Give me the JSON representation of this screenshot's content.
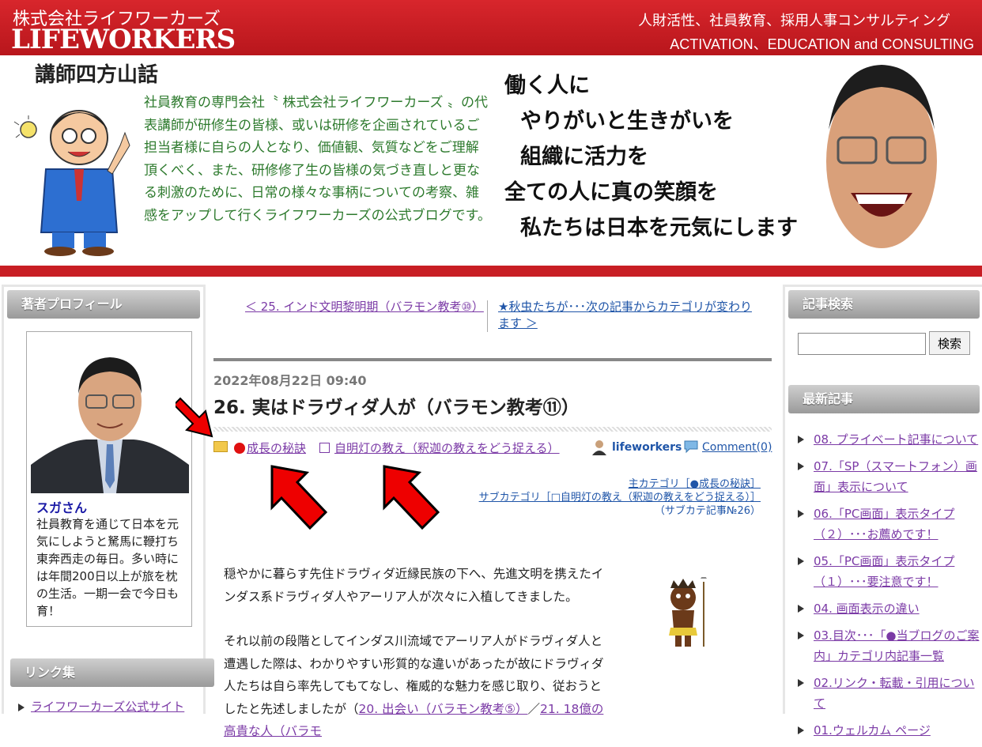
{
  "header": {
    "company_jp": "株式会社ライフワーカーズ",
    "company_en": "LIFEWORKERS",
    "tagline_jp": "人財活性、社員教育、採用人事コンサルティング",
    "tagline_en": "ACTIVATION、EDUCATION and CONSULTING",
    "blog_name": "講師四方山話",
    "intro": "社員教育の専門会社〝 株式会社ライフワーカーズ 〟の代表講師が研修生の皆様、或いは研修を企画されているご担当者様に自らの人となり、価値観、気質などをご理解頂くべく、また、研修修了生の皆様の気づき直しと更なる刺激のために、日常の様々な事柄についての考察、雑感をアップして行くライフワーカーズの公式ブログです。",
    "slogan": [
      "働く人に",
      "やりがいと生きがいを",
      "組織に活力を",
      "全ての人に真の笑顔を",
      "私たちは日本を元気にします"
    ]
  },
  "left_sidebar": {
    "profile_heading": "著者プロフィール",
    "author_name": "スガさん",
    "author_desc": "社員教育を通じて日本を元気にしようと駑馬に鞭打ち東奔西走の毎日。多い時には年間200日以上が旅を枕の生活。一期一会で今日も育！",
    "links_heading": "リンク集",
    "links": [
      "ライフワーカーズ公式サイト"
    ]
  },
  "right_sidebar": {
    "search_heading": "記事検索",
    "search_value": "",
    "search_button": "検索",
    "recent_heading": "最新記事",
    "recent": [
      "08. プライベート記事について",
      "07.「SP（スマートフォン）画面」表示について",
      "06.「PC画面」表示タイプ（２）･･･お薦めです！",
      "05.「PC画面」表示タイプ（１）･･･要注意です！",
      "04. 画面表示の違い",
      "03.目次･･･「●当ブログのご案内」カテゴリ内記事一覧",
      "02.リンク・転載・引用について",
      "01.ウェルカム ページ"
    ]
  },
  "main": {
    "prev": "＜ 25. インド文明黎明期（バラモン教考⑩）",
    "next": "★秋虫たちが･･･次の記事からカテゴリが変わります ＞",
    "date": "2022年08月22日 09:40",
    "title": "26. 実はドラヴィダ人が（バラモン教考⑪）",
    "category1": "成長の秘訣",
    "category2": "自明灯の教え（釈迦の教えをどう捉える）",
    "author": "lifeworkers",
    "comment": "Comment(0)",
    "cat_main": "主カテゴリ［●成長の秘訣］",
    "cat_sub": "サブカテゴリ［□自明灯の教え（釈迦の教えをどう捉える）］",
    "cat_count": "（サブカテ記事№26）",
    "para1": "穏やかに暮らす先住ドラヴィダ近縁民族の下へ、先進文明を携えたインダス系ドラヴィダ人やアーリア人が次々に入植してきました。",
    "para2": "それ以前の段階としてインダス川流域でアーリア人がドラヴィダ人と遭遇した際は、わかりやすい形質的な違いがあったが故にドラヴィダ人たちは自ら率先してもてなし、権威的な魅力を感じ取り、従おうとしたと先述しましたが（",
    "link1": "20. 出会い（バラモン教考⑤）",
    "sep": "／",
    "link2": "21. 18億の高貴な人（バラモ"
  },
  "colors": {
    "brand_red": "#c81e24",
    "link_purple": "#7b3aa6",
    "link_blue": "#1f55a8"
  }
}
